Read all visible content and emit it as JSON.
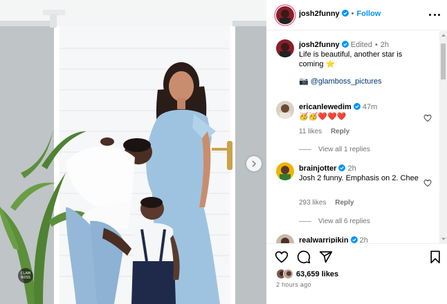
{
  "post": {
    "author": "josh2funny",
    "follow_label": "Follow",
    "separator": "•",
    "likes": "63,659 likes",
    "posted_time": "2 hours ago",
    "photo_watermark": "CLAM BOSS"
  },
  "caption": {
    "username": "josh2funny",
    "edited_label": "Edited",
    "time": "2h",
    "text": "Life is beautiful, another star is coming ⭐",
    "credit_icon": "📷",
    "credit_mention": "@glamboss_pictures"
  },
  "comments": [
    {
      "username": "ericanlewedim",
      "time": "47m",
      "text": "🥳🥳❤️❤️❤️",
      "likes": "11 likes",
      "reply_label": "Reply",
      "view_replies": "View all 1 replies"
    },
    {
      "username": "brainjotter",
      "time": "2h",
      "text": "Josh 2 funny. Emphasis on 2. Chee",
      "likes": "293 likes",
      "reply_label": "Reply",
      "view_replies": "View all 6 replies"
    },
    {
      "username": "realwarripikin",
      "time": "2h"
    }
  ],
  "icons": {
    "verified": "verified-badge-icon",
    "more": "more-options-icon",
    "heart": "heart-icon",
    "like": "like-icon",
    "comment": "comment-icon",
    "share": "share-icon",
    "save": "bookmark-icon",
    "next": "chevron-right-icon"
  },
  "colors": {
    "accent": "#0095f6",
    "verified": "#0095f6",
    "story_ring": "#d93a6d",
    "secondary_text": "#737373",
    "mention": "#00376b"
  }
}
